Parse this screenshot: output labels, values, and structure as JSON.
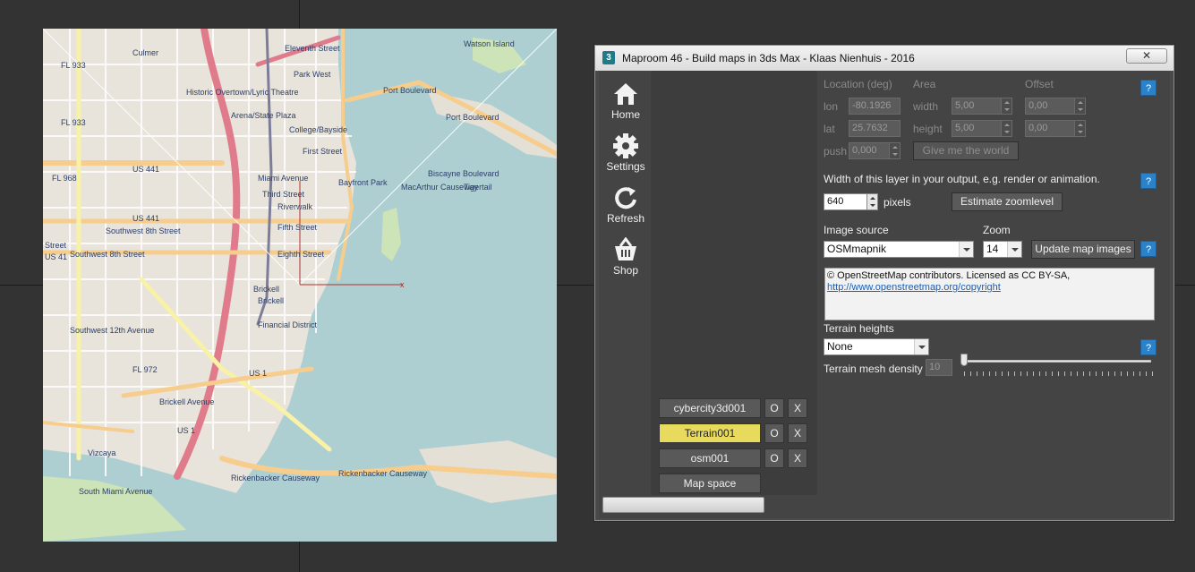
{
  "window": {
    "title": "Maproom 46 - Build maps in 3ds Max - Klaas Nienhuis - 2016",
    "close_label": "✕",
    "app_icon_label": "3"
  },
  "nav": [
    {
      "label": "Home",
      "icon": "home-icon"
    },
    {
      "label": "Settings",
      "icon": "gear-icon"
    },
    {
      "label": "Refresh",
      "icon": "refresh-icon"
    },
    {
      "label": "Shop",
      "icon": "shopping-basket-icon"
    }
  ],
  "layers": {
    "items": [
      {
        "name": "cybercity3d001",
        "active": false
      },
      {
        "name": "Terrain001",
        "active": true
      },
      {
        "name": "osm001",
        "active": false
      }
    ],
    "o_label": "O",
    "x_label": "X",
    "map_space_label": "Map space"
  },
  "location": {
    "heading": "Location (deg)",
    "area_heading": "Area",
    "offset_heading": "Offset",
    "lon_label": "lon",
    "lon_value": "-80.1926",
    "lat_label": "lat",
    "lat_value": "25.7632",
    "push_label": "push",
    "push_value": "0,000",
    "width_label": "width",
    "width_value": "5,00",
    "height_label": "height",
    "height_value": "5,00",
    "offset_x": "0,00",
    "offset_y": "0,00",
    "give_world_label": "Give me the world",
    "help": "?"
  },
  "output": {
    "description": "Width of this layer in your output, e.g. render or animation.",
    "value": "640",
    "unit": "pixels",
    "estimate_label": "Estimate zoomlevel",
    "help": "?"
  },
  "image": {
    "source_label": "Image source",
    "source_value": "OSMmapnik",
    "zoom_label": "Zoom",
    "zoom_value": "14",
    "update_label": "Update map images",
    "help": "?",
    "credits_text": "© OpenStreetMap contributors. Licensed as CC BY-SA,",
    "credits_link": "http://www.openstreetmap.org/copyright"
  },
  "terrain": {
    "heights_label": "Terrain heights",
    "heights_value": "None",
    "density_label": "Terrain mesh density",
    "density_value": "10",
    "help": "?"
  },
  "map": {
    "labels": [
      "Culmer",
      "Eleventh Street",
      "Watson Island",
      "FL 933",
      "Park West",
      "Historic Overtown/Lyric Theatre",
      "Port Boulevard",
      "Arena/State Plaza",
      "College/Bayside",
      "Port Boulevard",
      "FL 933",
      "First Street",
      "US 441",
      "FL 968",
      "Miami Avenue",
      "Bayfront Park",
      "Third Street",
      "Riverwalk",
      "US 441",
      "Fifth Street",
      "Southwest 8th Street",
      "Street",
      "Southwest 8th Street",
      "Eighth Street",
      "Brickell",
      "Brickell",
      "Financial District",
      "FL 972",
      "US 1",
      "Brickell Avenue",
      "US 1",
      "Vizcaya",
      "Rickenbacker Causeway",
      "Rickenbacker Causeway",
      "South Miami Avenue",
      "Southwest 12th Avenue",
      "US 41",
      "Biscayne Boulevard",
      "MacArthur Causeway",
      "Tigertail"
    ]
  }
}
